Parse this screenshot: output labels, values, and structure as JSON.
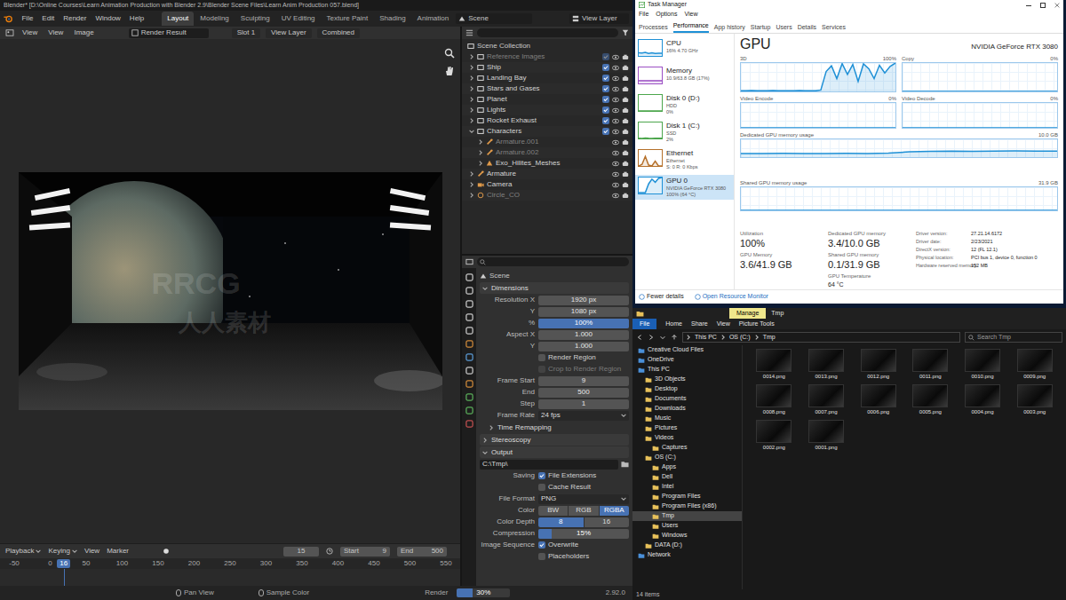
{
  "blender": {
    "title": "Blender* [D:\\Online Courses\\Learn Animation Production with Blender 2.9\\Blender Scene Files\\Learn Anim Production 057.blend]",
    "menus": [
      "File",
      "Edit",
      "Render",
      "Window",
      "Help"
    ],
    "workspaces": [
      {
        "label": "Layout",
        "selected": true
      },
      {
        "label": "Modeling",
        "selected": false
      },
      {
        "label": "Sculpting",
        "selected": false
      },
      {
        "label": "UV Editing",
        "selected": false
      },
      {
        "label": "Texture Paint",
        "selected": false
      },
      {
        "label": "Shading",
        "selected": false
      },
      {
        "label": "Animation",
        "selected": false
      }
    ],
    "scene": "Scene",
    "view_layer": "View Layer",
    "image_editor": {
      "menus": [
        "View",
        "View",
        "Image"
      ],
      "image": "Render Result",
      "slot": "Slot 1",
      "layer": "View Layer",
      "pass": "Combined"
    },
    "outliner": {
      "root": "Scene Collection",
      "items": [
        {
          "name": "Reference Images",
          "depth": 0,
          "kind": "collection",
          "expanded": false,
          "disabled": true,
          "checked": true
        },
        {
          "name": "Ship",
          "depth": 0,
          "kind": "collection",
          "expanded": false,
          "disabled": false,
          "checked": true
        },
        {
          "name": "Landing Bay",
          "depth": 0,
          "kind": "collection",
          "expanded": false,
          "disabled": false,
          "checked": true
        },
        {
          "name": "Stars and Gases",
          "depth": 0,
          "kind": "collection",
          "expanded": false,
          "disabled": false,
          "checked": true
        },
        {
          "name": "Planet",
          "depth": 0,
          "kind": "collection",
          "expanded": false,
          "disabled": false,
          "checked": true
        },
        {
          "name": "Lights",
          "depth": 0,
          "kind": "collection",
          "expanded": false,
          "disabled": false,
          "checked": true
        },
        {
          "name": "Rocket Exhaust",
          "depth": 0,
          "kind": "collection",
          "expanded": false,
          "disabled": false,
          "checked": true
        },
        {
          "name": "Characters",
          "depth": 0,
          "kind": "collection",
          "expanded": true,
          "disabled": false,
          "checked": true
        },
        {
          "name": "Armature.001",
          "depth": 1,
          "kind": "armature",
          "expanded": false,
          "disabled": true
        },
        {
          "name": "Armature.002",
          "depth": 1,
          "kind": "armature",
          "expanded": false,
          "disabled": true
        },
        {
          "name": "Exo_Hilites_Meshes",
          "depth": 1,
          "kind": "mesh",
          "expanded": false,
          "disabled": false
        },
        {
          "name": "Armature",
          "depth": 0,
          "kind": "armature",
          "expanded": false,
          "disabled": false
        },
        {
          "name": "Camera",
          "depth": 0,
          "kind": "camera",
          "expanded": false,
          "disabled": false
        },
        {
          "name": "Circle_CO",
          "depth": 0,
          "kind": "empty",
          "expanded": false,
          "disabled": true
        }
      ]
    },
    "properties": {
      "context": "Scene",
      "panels": [
        {
          "title": "Dimensions",
          "expanded": true,
          "sub": false,
          "rows": [
            {
              "kind": "field",
              "label": "Resolution X",
              "value": "1920 px"
            },
            {
              "kind": "field",
              "label": "Y",
              "value": "1080 px"
            },
            {
              "kind": "slider",
              "label": "%",
              "value": "100%",
              "level": 1
            },
            {
              "kind": "field",
              "label": "Aspect X",
              "value": "1.000"
            },
            {
              "kind": "field",
              "label": "Y",
              "value": "1.000"
            },
            {
              "kind": "checkbox",
              "label": "",
              "text": "Render Region",
              "checked": false,
              "disabled": false
            },
            {
              "kind": "checkbox",
              "label": "",
              "text": "Crop to Render Region",
              "checked": false,
              "disabled": true
            },
            {
              "kind": "field",
              "label": "Frame Start",
              "value": "9"
            },
            {
              "kind": "field",
              "label": "End",
              "value": "500"
            },
            {
              "kind": "field",
              "label": "Step",
              "value": "1"
            },
            {
              "kind": "select",
              "label": "Frame Rate",
              "value": "24 fps"
            }
          ]
        },
        {
          "title": "Time Remapping",
          "expanded": false,
          "sub": true,
          "rows": []
        },
        {
          "title": "Stereoscopy",
          "expanded": false,
          "sub": false,
          "rows": []
        },
        {
          "title": "Output",
          "expanded": true,
          "sub": false,
          "rows": [
            {
              "kind": "path",
              "label": "",
              "value": "C:\\Tmp\\"
            },
            {
              "kind": "checkbox",
              "label": "Saving",
              "text": "File Extensions",
              "checked": true,
              "disabled": false
            },
            {
              "kind": "checkbox",
              "label": "",
              "text": "Cache Result",
              "checked": false,
              "disabled": false
            },
            {
              "kind": "select",
              "label": "File Format",
              "value": "PNG"
            },
            {
              "kind": "toggle",
              "label": "Color",
              "options": [
                {
                  "label": "BW",
                  "selected": false
                },
                {
                  "label": "RGB",
                  "selected": false
                },
                {
                  "label": "RGBA",
                  "selected": true
                }
              ]
            },
            {
              "kind": "toggle",
              "label": "Color Depth",
              "options": [
                {
                  "label": "8",
                  "selected": true
                },
                {
                  "label": "16",
                  "selected": false
                }
              ]
            },
            {
              "kind": "slider",
              "label": "Compression",
              "value": "15%",
              "level": 0.15
            },
            {
              "kind": "checkbox",
              "label": "Image Sequence",
              "text": "Overwrite",
              "checked": true,
              "disabled": false
            },
            {
              "kind": "checkbox",
              "label": "",
              "text": "Placeholders",
              "checked": false,
              "disabled": false
            }
          ]
        }
      ]
    },
    "timeline": {
      "menus": [
        "Playback",
        "Keying",
        "View",
        "Marker"
      ],
      "current_frame": "15",
      "start_label": "Start",
      "start": "9",
      "end_label": "End",
      "end": "500",
      "ticks": [
        "-50",
        "0",
        "50",
        "100",
        "150",
        "200",
        "250",
        "300",
        "350",
        "400",
        "450",
        "500",
        "550"
      ],
      "playhead": "16"
    },
    "status_bar": {
      "items": [
        "Pan View",
        "Sample Color"
      ],
      "render": {
        "label": "Render",
        "reading": "30%",
        "level": 0.3
      },
      "version": "2.92.0"
    }
  },
  "task_manager": {
    "title": "Task Manager",
    "menus": [
      "File",
      "Options",
      "View"
    ],
    "tabs": [
      {
        "label": "Processes",
        "selected": false
      },
      {
        "label": "Performance",
        "selected": true
      },
      {
        "label": "App history",
        "selected": false
      },
      {
        "label": "Startup",
        "selected": false
      },
      {
        "label": "Users",
        "selected": false
      },
      {
        "label": "Details",
        "selected": false
      },
      {
        "label": "Services",
        "selected": false
      }
    ],
    "resources": [
      {
        "name": "CPU",
        "lines": [
          "16% 4.70 GHz"
        ],
        "selected": false,
        "color": "#1e90d6",
        "values": [
          20,
          18,
          22,
          16,
          19,
          15,
          17,
          16
        ]
      },
      {
        "name": "Memory",
        "lines": [
          "10.9/63.8 GB (17%)"
        ],
        "selected": false,
        "color": "#9b4fc4",
        "values": [
          17,
          17,
          17,
          17,
          17,
          17,
          17,
          17
        ]
      },
      {
        "name": "Disk 0 (D:)",
        "lines": [
          "HDD",
          "0%"
        ],
        "selected": false,
        "color": "#4ca64c",
        "values": [
          0,
          0,
          0,
          0,
          0,
          0,
          0,
          0
        ]
      },
      {
        "name": "Disk 1 (C:)",
        "lines": [
          "SSD",
          "2%"
        ],
        "selected": false,
        "color": "#4ca64c",
        "values": [
          2,
          0,
          3,
          1,
          0,
          2,
          1,
          2
        ]
      },
      {
        "name": "Ethernet",
        "lines": [
          "Ethernet",
          "S: 0 R: 0 Kbps"
        ],
        "selected": false,
        "color": "#b5702a",
        "values": [
          0,
          10,
          60,
          5,
          0,
          30,
          0,
          0
        ]
      },
      {
        "name": "GPU 0",
        "lines": [
          "NVIDIA GeForce RTX 3080",
          "100% (64 °C)"
        ],
        "selected": true,
        "color": "#1e90d6",
        "values": [
          5,
          5,
          6,
          60,
          90,
          70,
          95,
          100
        ]
      }
    ],
    "heading": "GPU",
    "model": "NVIDIA GeForce RTX 3080",
    "graphs": [
      {
        "title": "3D",
        "max": "100%",
        "values": [
          2,
          2,
          3,
          2,
          2,
          2,
          3,
          2,
          2,
          2,
          2,
          3,
          2,
          2,
          2,
          5,
          70,
          90,
          45,
          98,
          60,
          95,
          35,
          97,
          80,
          45,
          92,
          65,
          88,
          100
        ]
      },
      {
        "title": "Copy",
        "max": "0%",
        "values": [
          0,
          0,
          0,
          0,
          0,
          0,
          0,
          0,
          0,
          0
        ]
      },
      {
        "title": "Video Encode",
        "max": "0%",
        "values": [
          0,
          0,
          0,
          0,
          0,
          0,
          0,
          0,
          0,
          0
        ]
      },
      {
        "title": "Video Decode",
        "max": "0%",
        "values": [
          0,
          0,
          0,
          0,
          0,
          0,
          0,
          0,
          0,
          0
        ]
      }
    ],
    "memory_graphs": [
      {
        "title": "Dedicated GPU memory usage",
        "max": "10.0 GB",
        "values": [
          20,
          20,
          21,
          20,
          20,
          21,
          20,
          22,
          30,
          32,
          34,
          33,
          34,
          35,
          34,
          34
        ]
      },
      {
        "title": "Shared GPU memory usage",
        "max": "31.9 GB",
        "values": [
          0,
          0,
          0,
          0,
          0,
          0,
          0,
          0,
          0,
          0
        ]
      }
    ],
    "stats": [
      {
        "label": "Utilization",
        "value": "100%"
      },
      {
        "label": "Dedicated GPU memory",
        "value": "3.4/10.0 GB"
      },
      {
        "label": "GPU Memory",
        "value": "3.6/41.9 GB"
      },
      {
        "label": "Shared GPU memory",
        "value": "0.1/31.9 GB"
      },
      {
        "label": "GPU Temperature",
        "value": "64 °C"
      }
    ],
    "details": [
      {
        "label": "Driver version:",
        "value": "27.21.14.6172"
      },
      {
        "label": "Driver date:",
        "value": "2/23/2021"
      },
      {
        "label": "DirectX version:",
        "value": "12 (FL 12.1)"
      },
      {
        "label": "Physical location:",
        "value": "PCI bus 1, device 0, function 0"
      },
      {
        "label": "Hardware reserved memory:",
        "value": "152 MB"
      }
    ],
    "footer": [
      "Fewer details",
      "Open Resource Monitor"
    ]
  },
  "explorer": {
    "context_tab": "Manage",
    "title": "Tmp",
    "file_tab": "File",
    "tabs": [
      "Home",
      "Share",
      "View",
      "Picture Tools"
    ],
    "path": [
      "This PC",
      "OS (C:)",
      "Tmp"
    ],
    "search_placeholder": "Search Tmp",
    "nav": [
      {
        "label": "Creative Cloud Files",
        "depth": 0,
        "selected": false
      },
      {
        "label": "OneDrive",
        "depth": 0,
        "selected": false
      },
      {
        "label": "This PC",
        "depth": 0,
        "selected": false
      },
      {
        "label": "3D Objects",
        "depth": 1,
        "selected": false
      },
      {
        "label": "Desktop",
        "depth": 1,
        "selected": false
      },
      {
        "label": "Documents",
        "depth": 1,
        "selected": false
      },
      {
        "label": "Downloads",
        "depth": 1,
        "selected": false
      },
      {
        "label": "Music",
        "depth": 1,
        "selected": false
      },
      {
        "label": "Pictures",
        "depth": 1,
        "selected": false
      },
      {
        "label": "Videos",
        "depth": 1,
        "selected": false
      },
      {
        "label": "Captures",
        "depth": 2,
        "selected": false
      },
      {
        "label": "OS (C:)",
        "depth": 1,
        "selected": false
      },
      {
        "label": "Apps",
        "depth": 2,
        "selected": false
      },
      {
        "label": "Dell",
        "depth": 2,
        "selected": false
      },
      {
        "label": "Intel",
        "depth": 2,
        "selected": false
      },
      {
        "label": "Program Files",
        "depth": 2,
        "selected": false
      },
      {
        "label": "Program Files (x86)",
        "depth": 2,
        "selected": false
      },
      {
        "label": "Tmp",
        "depth": 2,
        "selected": true
      },
      {
        "label": "Users",
        "depth": 2,
        "selected": false
      },
      {
        "label": "Windows",
        "depth": 2,
        "selected": false
      },
      {
        "label": "DATA (D:)",
        "depth": 1,
        "selected": false
      },
      {
        "label": "Network",
        "depth": 0,
        "selected": false
      }
    ],
    "files": [
      "0014.png",
      "0013.png",
      "0012.png",
      "0011.png",
      "0010.png",
      "0009.png",
      "0008.png",
      "0007.png",
      "0006.png",
      "0005.png",
      "0004.png",
      "0003.png",
      "0002.png",
      "0001.png"
    ],
    "status": "14 items"
  },
  "watermark": [
    "RRCG",
    "人人素材"
  ]
}
